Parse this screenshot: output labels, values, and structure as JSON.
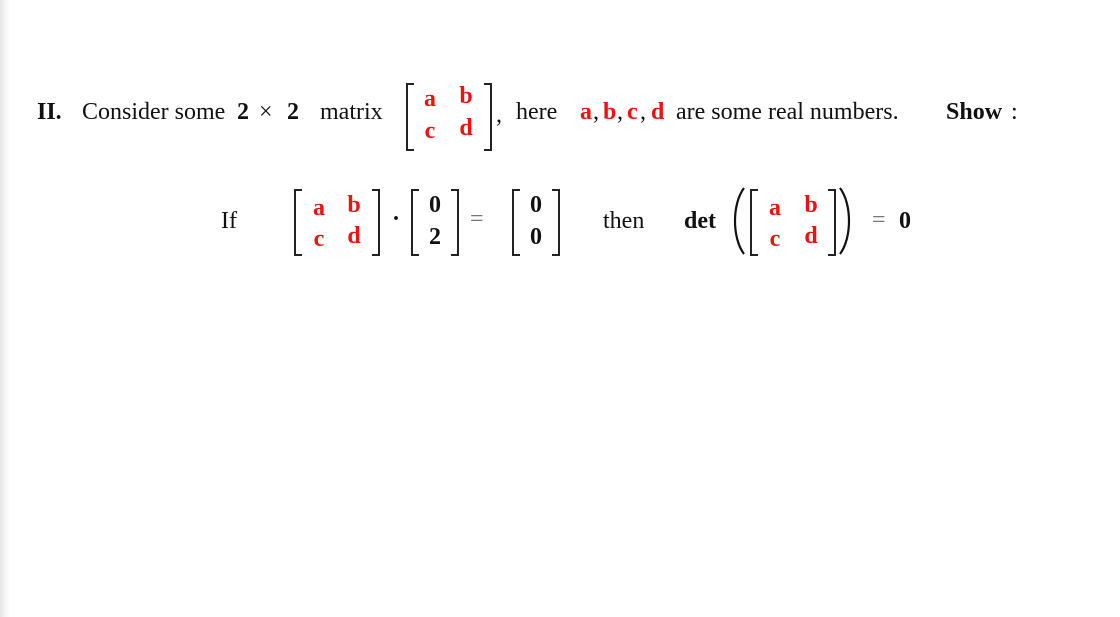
{
  "problem": {
    "number": "II.",
    "intro_text": "Consider some",
    "size_left": "2",
    "times": "×",
    "size_right": "2",
    "matrix_word": "matrix",
    "comma_after_matrix": ",",
    "here_word": "here",
    "variables": [
      "a",
      "b",
      "c",
      "d"
    ],
    "separator": ",",
    "rest_text": "are some real numbers.",
    "show_label": "Show",
    "show_colon": ":"
  },
  "matrix": {
    "entries": [
      [
        "a",
        "b"
      ],
      [
        "c",
        "d"
      ]
    ]
  },
  "statement": {
    "if_word": "If",
    "dot": "·",
    "vector_in": [
      "0",
      "2"
    ],
    "equals": "=",
    "vector_out": [
      "0",
      "0"
    ],
    "then_word": "then",
    "det_word": "det",
    "result_equals": "=",
    "result_value": "0"
  },
  "colors": {
    "variable_red": "#f01010",
    "text": "#111111"
  }
}
